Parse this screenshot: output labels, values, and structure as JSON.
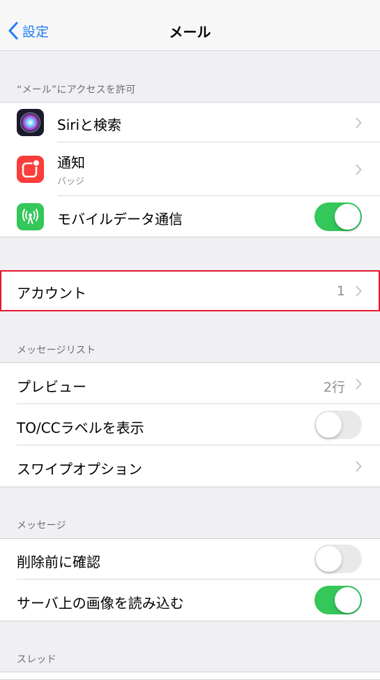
{
  "nav": {
    "back_label": "設定",
    "title": "メール"
  },
  "sections": {
    "access_header": "“メール”にアクセスを許可",
    "message_list_header": "メッセージリスト",
    "messages_header": "メッセージ",
    "thread_header": "スレッド"
  },
  "access": {
    "siri": {
      "label": "Siriと検索"
    },
    "notifications": {
      "label": "通知",
      "sub": "バッジ"
    },
    "cellular": {
      "label": "モバイルデータ通信",
      "enabled": true
    }
  },
  "accounts": {
    "label": "アカウント",
    "count": "1"
  },
  "message_list": {
    "preview": {
      "label": "プレビュー",
      "value": "2行"
    },
    "to_cc": {
      "label": "TO/CCラベルを表示",
      "enabled": false
    },
    "swipe": {
      "label": "スワイプオプション"
    }
  },
  "messages": {
    "confirm_delete": {
      "label": "削除前に確認",
      "enabled": false
    },
    "load_images": {
      "label": "サーバ上の画像を読み込む",
      "enabled": true
    }
  },
  "colors": {
    "accent": "#1e7cf5",
    "toggle_on": "#34c759",
    "highlight": "#e6162b"
  },
  "icons": {
    "back": "chevron-left-icon",
    "siri": "siri-icon",
    "notifications": "notifications-icon",
    "cellular": "cellular-antenna-icon",
    "disclosure": "chevron-right-icon"
  }
}
